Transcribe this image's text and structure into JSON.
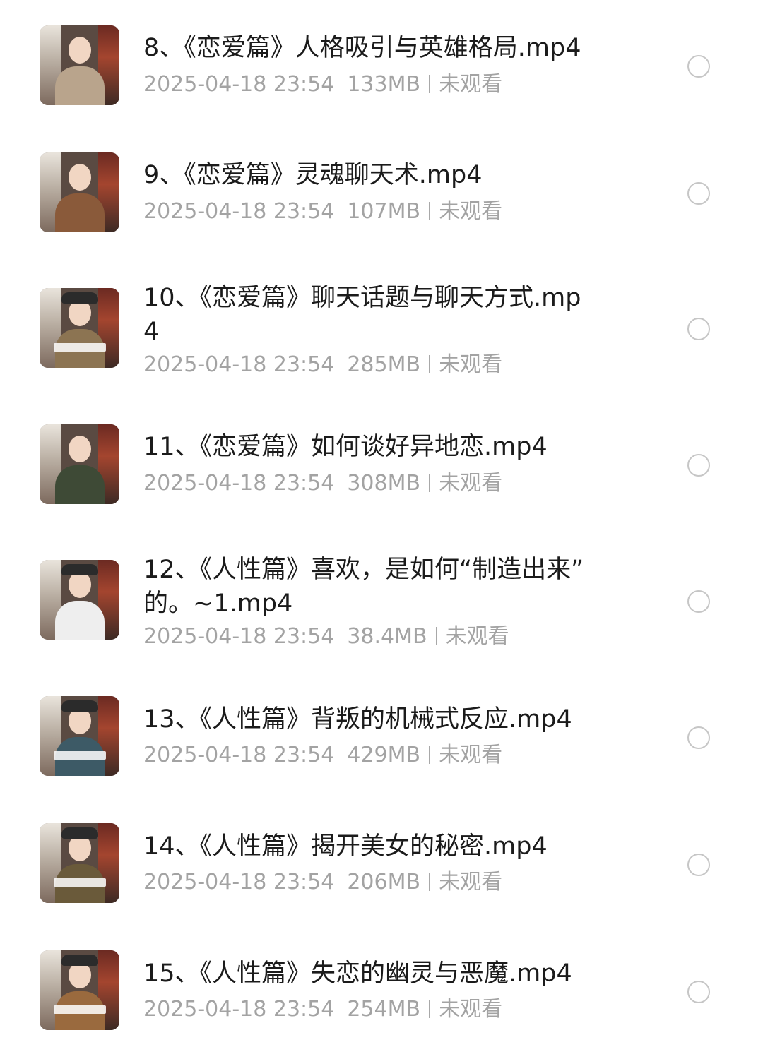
{
  "items": [
    {
      "title": "8、《恋爱篇》人格吸引与英雄格局.mp4",
      "date": "2025-04-18 23:54",
      "size": "133MB",
      "status": "未观看",
      "thumb_body_color": "#b9a48c",
      "thumb_hat": false,
      "thumb_caption": false
    },
    {
      "title": "9、《恋爱篇》灵魂聊天术.mp4",
      "date": "2025-04-18 23:54",
      "size": "107MB",
      "status": "未观看",
      "thumb_body_color": "#8a5a3a",
      "thumb_hat": false,
      "thumb_caption": false
    },
    {
      "title": "10、《恋爱篇》聊天话题与聊天方式.mp\n4",
      "date": "2025-04-18 23:54",
      "size": "285MB",
      "status": "未观看",
      "thumb_body_color": "#8c7452",
      "thumb_hat": true,
      "thumb_caption": true
    },
    {
      "title": "11、《恋爱篇》如何谈好异地恋.mp4",
      "date": "2025-04-18 23:54",
      "size": "308MB",
      "status": "未观看",
      "thumb_body_color": "#3e4a36",
      "thumb_hat": false,
      "thumb_caption": false
    },
    {
      "title": "12、《人性篇》喜欢，是如何“制造出来”\n的。~1.mp4",
      "date": "2025-04-18 23:54",
      "size": "38.4MB",
      "status": "未观看",
      "thumb_body_color": "#eeeeee",
      "thumb_hat": true,
      "thumb_caption": false
    },
    {
      "title": "13、《人性篇》背叛的机械式反应.mp4",
      "date": "2025-04-18 23:54",
      "size": "429MB",
      "status": "未观看",
      "thumb_body_color": "#3d5a66",
      "thumb_hat": true,
      "thumb_caption": true
    },
    {
      "title": "14、《人性篇》揭开美女的秘密.mp4",
      "date": "2025-04-18 23:54",
      "size": "206MB",
      "status": "未观看",
      "thumb_body_color": "#6a5a3a",
      "thumb_hat": true,
      "thumb_caption": true
    },
    {
      "title": "15、《人性篇》失恋的幽灵与恶魔.mp4",
      "date": "2025-04-18 23:54",
      "size": "254MB",
      "status": "未观看",
      "thumb_body_color": "#9a6a3e",
      "thumb_hat": true,
      "thumb_caption": true
    }
  ]
}
